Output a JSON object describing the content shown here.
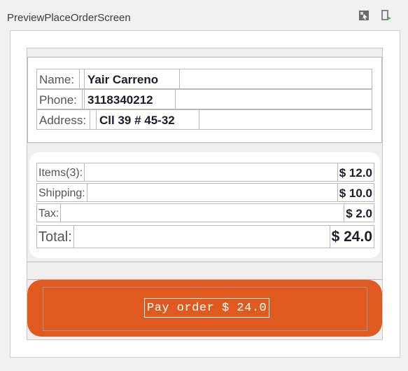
{
  "window": {
    "title": "PreviewPlaceOrderScreen"
  },
  "toolbar": {
    "icons": [
      "interactive-mode-icon",
      "deploy-preview-icon"
    ]
  },
  "customer": {
    "name_label": "Name:",
    "name": "Yair Carreno",
    "phone_label": "Phone:",
    "phone": "3118340212",
    "address_label": "Address:",
    "address": "Cll 39 # 45-32"
  },
  "summary": {
    "items_label": "Items(3):",
    "items_value": "$ 12.0",
    "shipping_label": "Shipping:",
    "shipping_value": "$ 10.0",
    "tax_label": "Tax:",
    "tax_value": "$ 2.0",
    "total_label": "Total:",
    "total_value": "$ 24.0"
  },
  "pay_button": {
    "label": "Pay order $ 24.0",
    "color": "#e05a1f"
  }
}
